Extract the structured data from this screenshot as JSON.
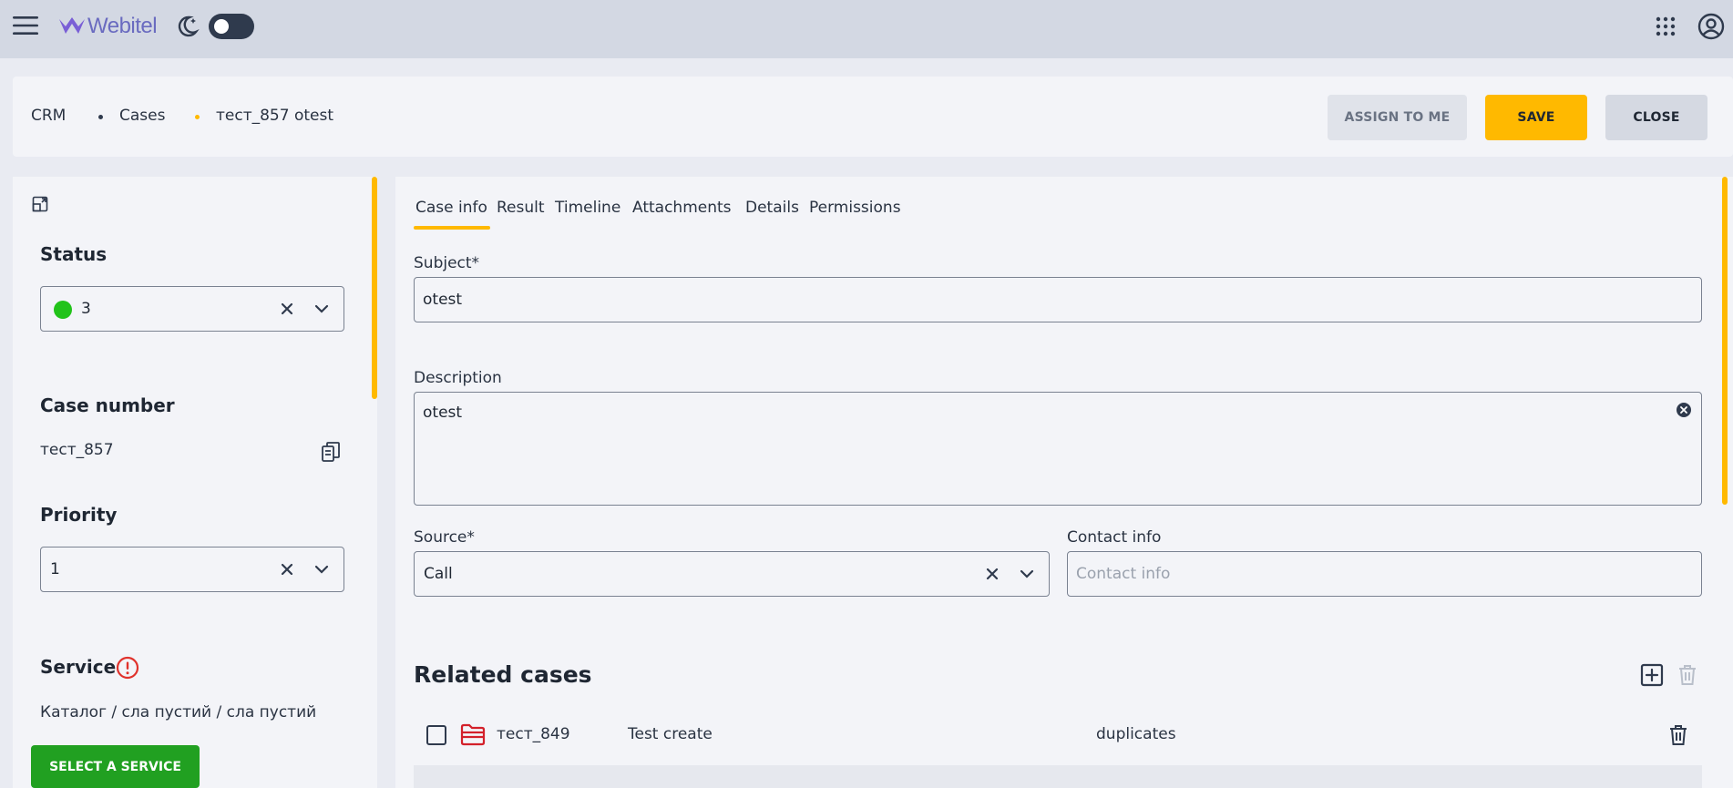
{
  "app": {
    "name": "Webitel"
  },
  "breadcrumb": [
    {
      "label": "CRM"
    },
    {
      "label": "Cases",
      "dot_color": "#2f3a4d"
    },
    {
      "label": "тест_857 otest",
      "dot_color": "#ffb900"
    }
  ],
  "actions": {
    "assign_label": "ASSIGN TO ME",
    "save_label": "SAVE",
    "close_label": "CLOSE"
  },
  "sidebar": {
    "status": {
      "label": "Status",
      "value": "3",
      "indicator_color": "#22c31a"
    },
    "case_number": {
      "label": "Case number",
      "value": "тест_857"
    },
    "priority": {
      "label": "Priority",
      "value": "1"
    },
    "service": {
      "label": "Service",
      "path": "Каталог / сла пустий / сла пустий",
      "button_label": "SELECT A SERVICE"
    }
  },
  "tabs": [
    {
      "label": "Case info",
      "active": true
    },
    {
      "label": "Result"
    },
    {
      "label": "Timeline"
    },
    {
      "label": "Attachments"
    },
    {
      "label": "Details"
    },
    {
      "label": "Permissions"
    }
  ],
  "form": {
    "subject": {
      "label": "Subject*",
      "value": "otest"
    },
    "description": {
      "label": "Description",
      "value": "otest"
    },
    "source": {
      "label": "Source*",
      "value": "Call"
    },
    "contact_info": {
      "label": "Contact info",
      "value": "",
      "placeholder": "Contact info"
    }
  },
  "related_cases": {
    "title": "Related cases",
    "rows": [
      {
        "id": "тест_849",
        "subject": "Test create",
        "relation": "duplicates"
      }
    ]
  },
  "colors": {
    "accent": "#ffb900",
    "topbar": "#d3d8e3",
    "service_button": "#21a021",
    "alert": "#e0322c"
  }
}
